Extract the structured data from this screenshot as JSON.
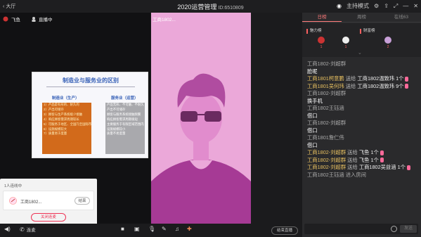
{
  "window": {
    "back_label": "大厅",
    "title": "2020运营管理",
    "room_id": "ID:6510809",
    "host_mode_label": "主持模式"
  },
  "left_stage": {
    "teacher_name": "飞鱼",
    "live_status": "直播中"
  },
  "slide": {
    "title": "制造业与服务业的区别",
    "left_header": "制造业（生产）",
    "right_header": "服务业（运营）",
    "left_lines": [
      "1）产品是有形的、耐久的",
      "2）产出可储存",
      "3）顾客与生产系统极少接触",
      "4）响应顾客需求周期较长",
      "5）可服务于地区、全国乃至国际市场",
      "6）设施规模较大",
      "7）质量易于度量"
    ],
    "right_lines": [
      "产品无形、不可触、不耐久",
      "产出不可储存",
      "顾客与服务系统接触频繁",
      "",
      "响应顾客需求周期很短",
      "主要服务于有限区域范围内",
      "",
      "设施规模较小",
      "质量不易度量"
    ]
  },
  "connect_panel": {
    "count_label": "1人连线中",
    "user_name": "工商1802...",
    "end_label": "结束",
    "close_label": "关闭连麦"
  },
  "video": {
    "label": "工商1802..."
  },
  "bottombar": {
    "mic_label": "连麦",
    "end_live_label": "结束直播"
  },
  "right_panel": {
    "tabs": [
      {
        "label": "日榜",
        "active": true
      },
      {
        "label": "周榜",
        "active": false
      },
      {
        "label": "在线63",
        "active": false
      }
    ],
    "rank_left_label": "魅力榜",
    "rank_right_label": "财富榜",
    "rank_numbers": [
      "1",
      "1",
      "2"
    ],
    "chat": [
      {
        "type": "name",
        "text": "工商1802-刘超群"
      },
      {
        "type": "msg",
        "text": "脸呢"
      },
      {
        "type": "gift",
        "user": "工商1801柯意鹏",
        "action": "送给",
        "target": "工商1802温致玮",
        "count": "1个"
      },
      {
        "type": "gift",
        "user": "工商1801吴何玮",
        "action": "送给",
        "target": "工商1802温致玮",
        "count": "9个"
      },
      {
        "type": "name",
        "text": "工商1802-刘超群"
      },
      {
        "type": "msg",
        "text": "换手机"
      },
      {
        "type": "name",
        "text": "工商1802王钰涵"
      },
      {
        "type": "msg",
        "text": "借口"
      },
      {
        "type": "name",
        "text": "工商1802-刘超群"
      },
      {
        "type": "msg",
        "text": "借口"
      },
      {
        "type": "name",
        "text": "工商1801詹仁伟"
      },
      {
        "type": "msg",
        "text": "借口"
      },
      {
        "type": "gift",
        "user": "工商1802-刘超群",
        "action": "送给",
        "target": "飞鱼",
        "count": "1个"
      },
      {
        "type": "gift",
        "user": "工商1802-刘超群",
        "action": "送给",
        "target": "飞鱼",
        "count": "1个"
      },
      {
        "type": "gift",
        "user": "工商1802-刘超群",
        "action": "送给",
        "target": "工商1802吴益涵",
        "count": "1个"
      },
      {
        "type": "sys",
        "text": "工商1802王钰涵 进入房间"
      }
    ],
    "send_label": "发送"
  },
  "colors": {
    "accent": "#ff7a7a",
    "video_bg": "#eba8d9",
    "slide_left_box": "#d26a1b",
    "slide_right_box": "#a9a9ad"
  }
}
